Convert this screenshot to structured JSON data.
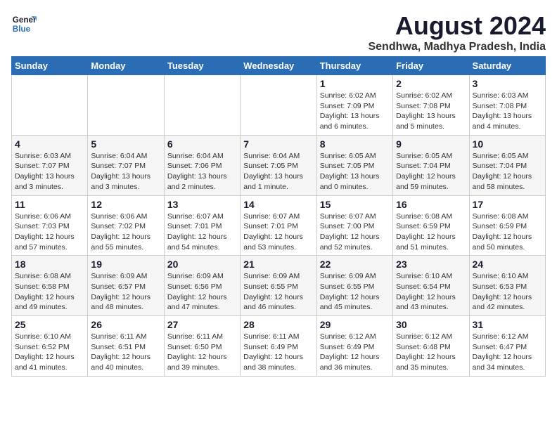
{
  "header": {
    "logo_line1": "General",
    "logo_line2": "Blue",
    "title": "August 2024",
    "subtitle": "Sendhwa, Madhya Pradesh, India"
  },
  "weekdays": [
    "Sunday",
    "Monday",
    "Tuesday",
    "Wednesday",
    "Thursday",
    "Friday",
    "Saturday"
  ],
  "weeks": [
    [
      {
        "day": "",
        "info": ""
      },
      {
        "day": "",
        "info": ""
      },
      {
        "day": "",
        "info": ""
      },
      {
        "day": "",
        "info": ""
      },
      {
        "day": "1",
        "info": "Sunrise: 6:02 AM\nSunset: 7:09 PM\nDaylight: 13 hours\nand 6 minutes."
      },
      {
        "day": "2",
        "info": "Sunrise: 6:02 AM\nSunset: 7:08 PM\nDaylight: 13 hours\nand 5 minutes."
      },
      {
        "day": "3",
        "info": "Sunrise: 6:03 AM\nSunset: 7:08 PM\nDaylight: 13 hours\nand 4 minutes."
      }
    ],
    [
      {
        "day": "4",
        "info": "Sunrise: 6:03 AM\nSunset: 7:07 PM\nDaylight: 13 hours\nand 3 minutes."
      },
      {
        "day": "5",
        "info": "Sunrise: 6:04 AM\nSunset: 7:07 PM\nDaylight: 13 hours\nand 3 minutes."
      },
      {
        "day": "6",
        "info": "Sunrise: 6:04 AM\nSunset: 7:06 PM\nDaylight: 13 hours\nand 2 minutes."
      },
      {
        "day": "7",
        "info": "Sunrise: 6:04 AM\nSunset: 7:05 PM\nDaylight: 13 hours\nand 1 minute."
      },
      {
        "day": "8",
        "info": "Sunrise: 6:05 AM\nSunset: 7:05 PM\nDaylight: 13 hours\nand 0 minutes."
      },
      {
        "day": "9",
        "info": "Sunrise: 6:05 AM\nSunset: 7:04 PM\nDaylight: 12 hours\nand 59 minutes."
      },
      {
        "day": "10",
        "info": "Sunrise: 6:05 AM\nSunset: 7:04 PM\nDaylight: 12 hours\nand 58 minutes."
      }
    ],
    [
      {
        "day": "11",
        "info": "Sunrise: 6:06 AM\nSunset: 7:03 PM\nDaylight: 12 hours\nand 57 minutes."
      },
      {
        "day": "12",
        "info": "Sunrise: 6:06 AM\nSunset: 7:02 PM\nDaylight: 12 hours\nand 55 minutes."
      },
      {
        "day": "13",
        "info": "Sunrise: 6:07 AM\nSunset: 7:01 PM\nDaylight: 12 hours\nand 54 minutes."
      },
      {
        "day": "14",
        "info": "Sunrise: 6:07 AM\nSunset: 7:01 PM\nDaylight: 12 hours\nand 53 minutes."
      },
      {
        "day": "15",
        "info": "Sunrise: 6:07 AM\nSunset: 7:00 PM\nDaylight: 12 hours\nand 52 minutes."
      },
      {
        "day": "16",
        "info": "Sunrise: 6:08 AM\nSunset: 6:59 PM\nDaylight: 12 hours\nand 51 minutes."
      },
      {
        "day": "17",
        "info": "Sunrise: 6:08 AM\nSunset: 6:59 PM\nDaylight: 12 hours\nand 50 minutes."
      }
    ],
    [
      {
        "day": "18",
        "info": "Sunrise: 6:08 AM\nSunset: 6:58 PM\nDaylight: 12 hours\nand 49 minutes."
      },
      {
        "day": "19",
        "info": "Sunrise: 6:09 AM\nSunset: 6:57 PM\nDaylight: 12 hours\nand 48 minutes."
      },
      {
        "day": "20",
        "info": "Sunrise: 6:09 AM\nSunset: 6:56 PM\nDaylight: 12 hours\nand 47 minutes."
      },
      {
        "day": "21",
        "info": "Sunrise: 6:09 AM\nSunset: 6:55 PM\nDaylight: 12 hours\nand 46 minutes."
      },
      {
        "day": "22",
        "info": "Sunrise: 6:09 AM\nSunset: 6:55 PM\nDaylight: 12 hours\nand 45 minutes."
      },
      {
        "day": "23",
        "info": "Sunrise: 6:10 AM\nSunset: 6:54 PM\nDaylight: 12 hours\nand 43 minutes."
      },
      {
        "day": "24",
        "info": "Sunrise: 6:10 AM\nSunset: 6:53 PM\nDaylight: 12 hours\nand 42 minutes."
      }
    ],
    [
      {
        "day": "25",
        "info": "Sunrise: 6:10 AM\nSunset: 6:52 PM\nDaylight: 12 hours\nand 41 minutes."
      },
      {
        "day": "26",
        "info": "Sunrise: 6:11 AM\nSunset: 6:51 PM\nDaylight: 12 hours\nand 40 minutes."
      },
      {
        "day": "27",
        "info": "Sunrise: 6:11 AM\nSunset: 6:50 PM\nDaylight: 12 hours\nand 39 minutes."
      },
      {
        "day": "28",
        "info": "Sunrise: 6:11 AM\nSunset: 6:49 PM\nDaylight: 12 hours\nand 38 minutes."
      },
      {
        "day": "29",
        "info": "Sunrise: 6:12 AM\nSunset: 6:49 PM\nDaylight: 12 hours\nand 36 minutes."
      },
      {
        "day": "30",
        "info": "Sunrise: 6:12 AM\nSunset: 6:48 PM\nDaylight: 12 hours\nand 35 minutes."
      },
      {
        "day": "31",
        "info": "Sunrise: 6:12 AM\nSunset: 6:47 PM\nDaylight: 12 hours\nand 34 minutes."
      }
    ]
  ]
}
